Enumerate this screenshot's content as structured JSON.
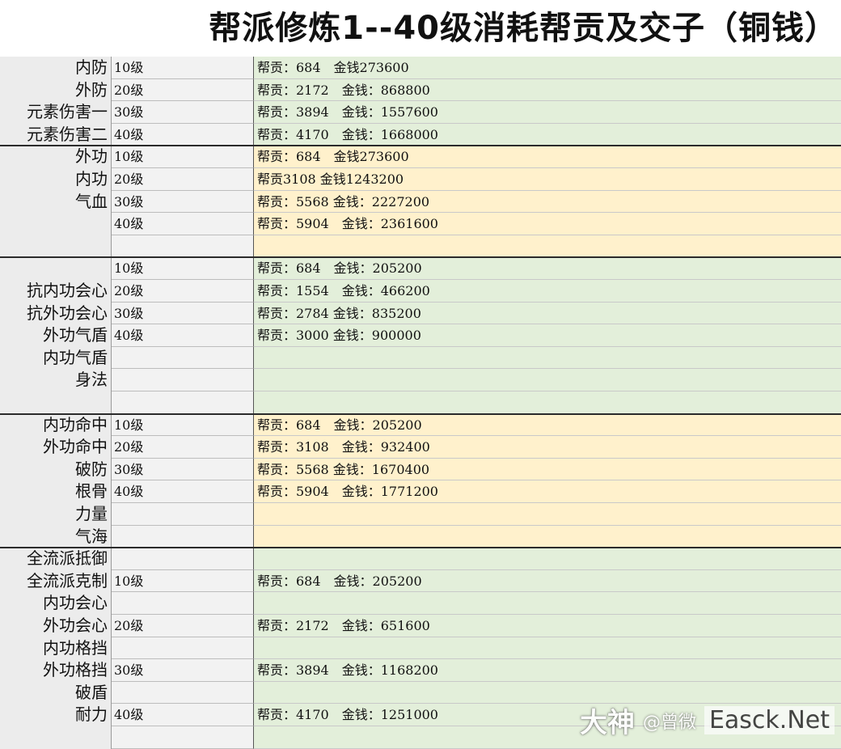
{
  "title": "帮派修炼1--40级消耗帮贡及交子（铜钱）",
  "rows": [
    {
      "name": "内防",
      "level": "10级",
      "cost": "帮贡：684　金钱273600",
      "color": "green"
    },
    {
      "name": "外防",
      "level": "20级",
      "cost": "帮贡：2172　金钱：868800",
      "color": "green"
    },
    {
      "name": "元素伤害一",
      "level": "30级",
      "cost": "帮贡：3894　金钱：1557600",
      "color": "green"
    },
    {
      "name": "元素伤害二",
      "level": "40级",
      "cost": "帮贡：4170　金钱：1668000",
      "color": "green"
    },
    {
      "name": "外功",
      "level": "10级",
      "cost": "帮贡：684　金钱273600",
      "color": "yellow"
    },
    {
      "name": "内功",
      "level": "20级",
      "cost": "帮贡3108 金钱1243200",
      "color": "yellow"
    },
    {
      "name": "气血",
      "level": "30级",
      "cost": "帮贡：5568 金钱：2227200",
      "color": "yellow"
    },
    {
      "name": "",
      "level": "40级",
      "cost": "帮贡：5904　金钱：2361600",
      "color": "yellow"
    },
    {
      "name": "",
      "level": "",
      "cost": "",
      "color": "yellow"
    },
    {
      "name": "",
      "level": "10级",
      "cost": "帮贡：684　金钱：205200",
      "color": "green"
    },
    {
      "name": "抗内功会心",
      "level": "20级",
      "cost": "帮贡：1554　金钱：466200",
      "color": "green"
    },
    {
      "name": "抗外功会心",
      "level": "30级",
      "cost": "帮贡：2784 金钱：835200",
      "color": "green"
    },
    {
      "name": "外功气盾",
      "level": "40级",
      "cost": "帮贡：3000 金钱：900000",
      "color": "green"
    },
    {
      "name": "内功气盾",
      "level": "",
      "cost": "",
      "color": "green"
    },
    {
      "name": "身法",
      "level": "",
      "cost": "",
      "color": "green"
    },
    {
      "name": "",
      "level": "",
      "cost": "",
      "color": "green"
    },
    {
      "name": "内功命中",
      "level": "10级",
      "cost": "帮贡：684　金钱：205200",
      "color": "yellow"
    },
    {
      "name": "外功命中",
      "level": "20级",
      "cost": "帮贡：3108　金钱：932400",
      "color": "yellow"
    },
    {
      "name": "破防",
      "level": "30级",
      "cost": "帮贡：5568 金钱：1670400",
      "color": "yellow"
    },
    {
      "name": "根骨",
      "level": "40级",
      "cost": "帮贡：5904　金钱：1771200",
      "color": "yellow"
    },
    {
      "name": "力量",
      "level": "",
      "cost": "",
      "color": "yellow"
    },
    {
      "name": "气海",
      "level": "",
      "cost": "",
      "color": "yellow"
    },
    {
      "name": "全流派抵御",
      "level": "",
      "cost": "",
      "color": "green"
    },
    {
      "name": "全流派克制",
      "level": "10级",
      "cost": "帮贡：684　金钱：205200",
      "color": "green"
    },
    {
      "name": "内功会心",
      "level": "",
      "cost": "",
      "color": "green"
    },
    {
      "name": "外功会心",
      "level": "20级",
      "cost": "帮贡：2172　金钱：651600",
      "color": "green"
    },
    {
      "name": "内功格挡",
      "level": "",
      "cost": "",
      "color": "green"
    },
    {
      "name": "外功格挡",
      "level": "30级",
      "cost": "帮贡：3894　金钱：1168200",
      "color": "green"
    },
    {
      "name": "破盾",
      "level": "",
      "cost": "",
      "color": "green"
    },
    {
      "name": "耐力",
      "level": "40级",
      "cost": "帮贡：4170　金钱：1251000",
      "color": "green"
    },
    {
      "name": "",
      "level": "",
      "cost": "",
      "color": "green"
    }
  ],
  "group_separators_after_row": [
    3,
    8,
    15,
    21
  ],
  "watermark": {
    "logo": "大神",
    "user": "@曾微",
    "site": "Easck.Net"
  }
}
